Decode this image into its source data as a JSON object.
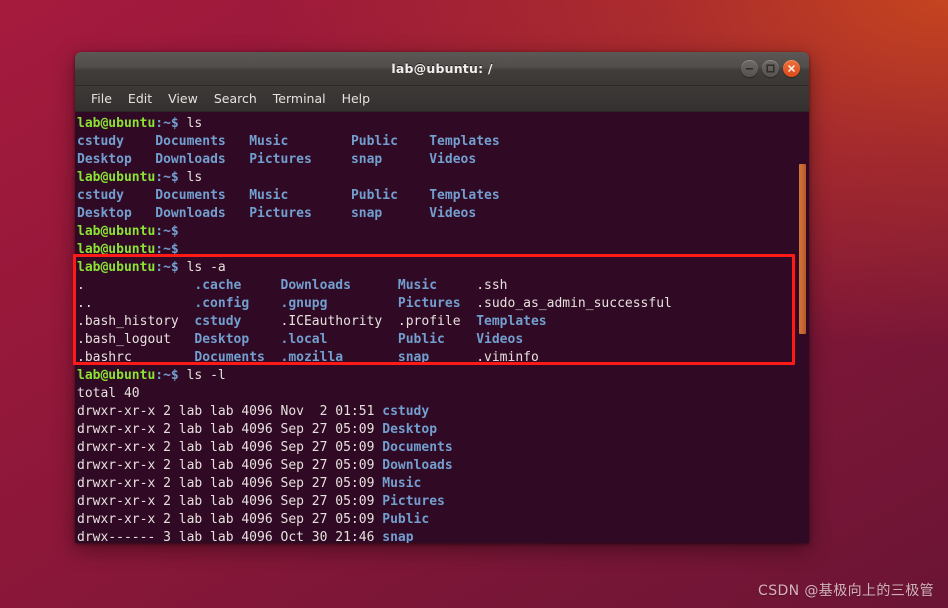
{
  "window": {
    "title": "lab@ubuntu: /",
    "controls": [
      {
        "name": "minimize",
        "glyph": "minimize-icon"
      },
      {
        "name": "maximize",
        "glyph": "maximize-icon"
      },
      {
        "name": "close",
        "glyph": "close-icon"
      }
    ]
  },
  "menubar": {
    "items": [
      {
        "label": "File"
      },
      {
        "label": "Edit"
      },
      {
        "label": "View"
      },
      {
        "label": "Search"
      },
      {
        "label": "Terminal"
      },
      {
        "label": "Help"
      }
    ]
  },
  "colors": {
    "terminal_background": "#300a24",
    "prompt_green": "#8ae234",
    "directory_blue": "#729fcf",
    "plain_text": "#e7e1de",
    "annotation_red": "#fd1a17",
    "scrollbar_orange": "#c4642f",
    "titlebar_gray": "#4a4643",
    "desktop_maroon": "#97183a"
  },
  "terminal": {
    "prompt": "lab@ubuntu",
    "prompt_path": ":~$",
    "lines": [
      {
        "type": "command",
        "prompt": "lab@ubuntu",
        "path": ":~$",
        "command": " ls"
      },
      {
        "type": "dirrow",
        "cells": [
          "cstudy",
          "Documents",
          "Music",
          "Public",
          "Templates"
        ]
      },
      {
        "type": "dirrow",
        "cells": [
          "Desktop",
          "Downloads",
          "Pictures",
          "snap",
          "Videos"
        ]
      },
      {
        "type": "command",
        "prompt": "lab@ubuntu",
        "path": ":~$",
        "command": " ls"
      },
      {
        "type": "dirrow",
        "cells": [
          "cstudy",
          "Documents",
          "Music",
          "Public",
          "Templates"
        ]
      },
      {
        "type": "dirrow",
        "cells": [
          "Desktop",
          "Downloads",
          "Pictures",
          "snap",
          "Videos"
        ]
      },
      {
        "type": "command",
        "prompt": "lab@ubuntu",
        "path": ":~$",
        "command": ""
      },
      {
        "type": "command",
        "prompt": "lab@ubuntu",
        "path": ":~$",
        "command": ""
      },
      {
        "type": "command",
        "prompt": "lab@ubuntu",
        "path": ":~$",
        "command": " ls -a"
      },
      {
        "type": "mixedrow",
        "cells": [
          {
            "text": ".",
            "kind": "plain"
          },
          {
            "text": ".cache",
            "kind": "dir"
          },
          {
            "text": "Downloads",
            "kind": "dir"
          },
          {
            "text": "Music",
            "kind": "dir"
          },
          {
            "text": ".ssh",
            "kind": "plain"
          }
        ]
      },
      {
        "type": "mixedrow",
        "cells": [
          {
            "text": "..",
            "kind": "plain"
          },
          {
            "text": ".config",
            "kind": "dir"
          },
          {
            "text": ".gnupg",
            "kind": "dir"
          },
          {
            "text": "Pictures",
            "kind": "dir"
          },
          {
            "text": ".sudo_as_admin_successful",
            "kind": "plain"
          }
        ]
      },
      {
        "type": "mixedrow",
        "cells": [
          {
            "text": ".bash_history",
            "kind": "plain"
          },
          {
            "text": "cstudy",
            "kind": "dir"
          },
          {
            "text": ".ICEauthority",
            "kind": "plain"
          },
          {
            "text": ".profile",
            "kind": "plain"
          },
          {
            "text": "Templates",
            "kind": "dir"
          }
        ]
      },
      {
        "type": "mixedrow",
        "cells": [
          {
            "text": ".bash_logout",
            "kind": "plain"
          },
          {
            "text": "Desktop",
            "kind": "dir"
          },
          {
            "text": ".local",
            "kind": "dir"
          },
          {
            "text": "Public",
            "kind": "dir"
          },
          {
            "text": "Videos",
            "kind": "dir"
          }
        ]
      },
      {
        "type": "mixedrow",
        "cells": [
          {
            "text": ".bashrc",
            "kind": "plain"
          },
          {
            "text": "Documents",
            "kind": "dir"
          },
          {
            "text": ".mozilla",
            "kind": "dir"
          },
          {
            "text": "snap",
            "kind": "dir"
          },
          {
            "text": ".viminfo",
            "kind": "plain"
          }
        ]
      },
      {
        "type": "command",
        "prompt": "lab@ubuntu",
        "path": ":~$",
        "command": " ls -l"
      },
      {
        "type": "plain",
        "text": "total 40"
      },
      {
        "type": "longrow",
        "perms": "drwxr-xr-x",
        "links": "2",
        "owner": "lab",
        "group": "lab",
        "size": "4096",
        "month": "Nov",
        "day": " 2",
        "time": "01:51",
        "name": "cstudy"
      },
      {
        "type": "longrow",
        "perms": "drwxr-xr-x",
        "links": "2",
        "owner": "lab",
        "group": "lab",
        "size": "4096",
        "month": "Sep",
        "day": "27",
        "time": "05:09",
        "name": "Desktop"
      },
      {
        "type": "longrow",
        "perms": "drwxr-xr-x",
        "links": "2",
        "owner": "lab",
        "group": "lab",
        "size": "4096",
        "month": "Sep",
        "day": "27",
        "time": "05:09",
        "name": "Documents"
      },
      {
        "type": "longrow",
        "perms": "drwxr-xr-x",
        "links": "2",
        "owner": "lab",
        "group": "lab",
        "size": "4096",
        "month": "Sep",
        "day": "27",
        "time": "05:09",
        "name": "Downloads"
      },
      {
        "type": "longrow",
        "perms": "drwxr-xr-x",
        "links": "2",
        "owner": "lab",
        "group": "lab",
        "size": "4096",
        "month": "Sep",
        "day": "27",
        "time": "05:09",
        "name": "Music"
      },
      {
        "type": "longrow",
        "perms": "drwxr-xr-x",
        "links": "2",
        "owner": "lab",
        "group": "lab",
        "size": "4096",
        "month": "Sep",
        "day": "27",
        "time": "05:09",
        "name": "Pictures"
      },
      {
        "type": "longrow",
        "perms": "drwxr-xr-x",
        "links": "2",
        "owner": "lab",
        "group": "lab",
        "size": "4096",
        "month": "Sep",
        "day": "27",
        "time": "05:09",
        "name": "Public"
      },
      {
        "type": "longrow",
        "perms": "drwx------",
        "links": "3",
        "owner": "lab",
        "group": "lab",
        "size": "4096",
        "month": "Oct",
        "day": "30",
        "time": "21:46",
        "name": "snap"
      }
    ]
  },
  "annotation": {
    "type": "red-rectangle-highlight",
    "targets_line": "ls -a output block"
  },
  "watermark": {
    "text": "CSDN @基极向上的三极管"
  }
}
